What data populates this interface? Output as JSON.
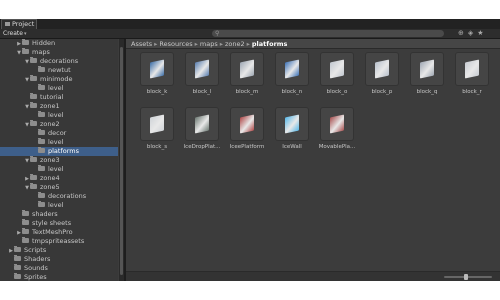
{
  "window": {
    "tab_label": "Project"
  },
  "toolbar": {
    "create_label": "Create",
    "search_placeholder": ""
  },
  "tree": [
    {
      "label": "Hidden",
      "depth": 1,
      "arrow": "closed"
    },
    {
      "label": "maps",
      "depth": 1,
      "arrow": "open"
    },
    {
      "label": "decorations",
      "depth": 2,
      "arrow": "open"
    },
    {
      "label": "newtut",
      "depth": 3,
      "arrow": ""
    },
    {
      "label": "minimode",
      "depth": 2,
      "arrow": "open"
    },
    {
      "label": "level",
      "depth": 3,
      "arrow": ""
    },
    {
      "label": "tutorial",
      "depth": 2,
      "arrow": ""
    },
    {
      "label": "zone1",
      "depth": 2,
      "arrow": "open"
    },
    {
      "label": "level",
      "depth": 3,
      "arrow": ""
    },
    {
      "label": "zone2",
      "depth": 2,
      "arrow": "open"
    },
    {
      "label": "decor",
      "depth": 3,
      "arrow": ""
    },
    {
      "label": "level",
      "depth": 3,
      "arrow": ""
    },
    {
      "label": "platforms",
      "depth": 3,
      "arrow": "",
      "selected": true
    },
    {
      "label": "zone3",
      "depth": 2,
      "arrow": "open"
    },
    {
      "label": "level",
      "depth": 3,
      "arrow": ""
    },
    {
      "label": "zone4",
      "depth": 2,
      "arrow": "closed"
    },
    {
      "label": "zone5",
      "depth": 2,
      "arrow": "open"
    },
    {
      "label": "decorations",
      "depth": 3,
      "arrow": ""
    },
    {
      "label": "level",
      "depth": 3,
      "arrow": ""
    },
    {
      "label": "shaders",
      "depth": 1,
      "arrow": ""
    },
    {
      "label": "style sheets",
      "depth": 1,
      "arrow": ""
    },
    {
      "label": "TextMeshPro",
      "depth": 1,
      "arrow": "closed"
    },
    {
      "label": "tmpspriteassets",
      "depth": 1,
      "arrow": ""
    },
    {
      "label": "Scripts",
      "depth": 0,
      "arrow": "closed"
    },
    {
      "label": "Shaders",
      "depth": 0,
      "arrow": ""
    },
    {
      "label": "Sounds",
      "depth": 0,
      "arrow": ""
    },
    {
      "label": "Sprites",
      "depth": 0,
      "arrow": ""
    }
  ],
  "breadcrumb": [
    "Assets",
    "Resources",
    "maps",
    "zone2",
    "platforms"
  ],
  "assets": [
    {
      "name": "block_k",
      "color": "#3d6fa8"
    },
    {
      "name": "block_l",
      "color": "#5a7fb0"
    },
    {
      "name": "block_m",
      "color": "#9fa8b4"
    },
    {
      "name": "block_n",
      "color": "#3f74b8"
    },
    {
      "name": "block_o",
      "color": "#c2c8d0"
    },
    {
      "name": "block_p",
      "color": "#b8c0cc"
    },
    {
      "name": "block_q",
      "color": "#a0a8b4"
    },
    {
      "name": "block_r",
      "color": "#c8ccd2"
    },
    {
      "name": "block_s",
      "color": "#d0d4d8"
    },
    {
      "name": "IceDropPlat...",
      "color": "#6e7a74"
    },
    {
      "name": "IceePlatform",
      "color": "#b04848"
    },
    {
      "name": "IceWall",
      "color": "#58b8e8"
    },
    {
      "name": "MovablePla...",
      "color": "#a85050"
    }
  ]
}
